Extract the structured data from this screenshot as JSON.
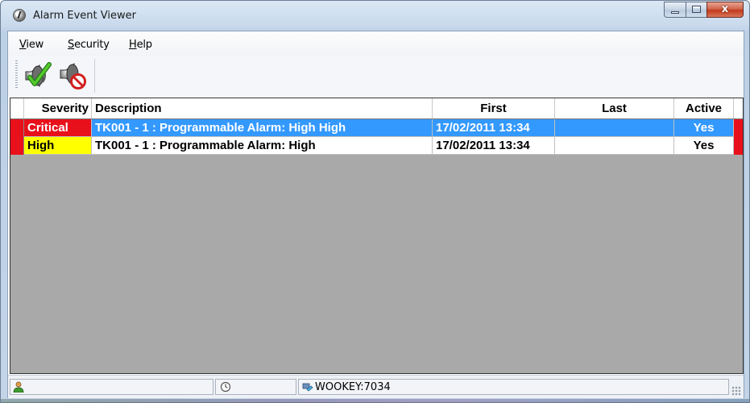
{
  "window": {
    "title": "Alarm Event Viewer",
    "close_glyph": "x"
  },
  "menu": {
    "items": [
      {
        "pre": "",
        "u": "V",
        "post": "iew"
      },
      {
        "pre": "",
        "u": "S",
        "post": "ecurity"
      },
      {
        "pre": "",
        "u": "H",
        "post": "elp"
      }
    ]
  },
  "toolbar": {
    "buttons": [
      {
        "icon": "speaker-acknowledge-icon"
      },
      {
        "icon": "speaker-muted-icon"
      }
    ]
  },
  "grid": {
    "columns": [
      "Severity",
      "Description",
      "First",
      "Last",
      "Active"
    ],
    "rows": [
      {
        "severity": "Critical",
        "description": "TK001 - 1 : Programmable Alarm: High High",
        "first": "17/02/2011 13:34",
        "last": "",
        "active": "Yes",
        "selected": true,
        "severity_color": "#e8101a",
        "indicator_color": "#e8101a"
      },
      {
        "severity": "High",
        "description": "TK001 - 1 : Programmable Alarm: High",
        "first": "17/02/2011 13:34",
        "last": "",
        "active": "Yes",
        "selected": false,
        "severity_color": "#ffff00",
        "indicator_color": "#e8101a"
      }
    ],
    "selection_color": "#3399ff",
    "empty_color": "#a9a9a9"
  },
  "statusbar": {
    "server": "WOOKEY:7034"
  }
}
